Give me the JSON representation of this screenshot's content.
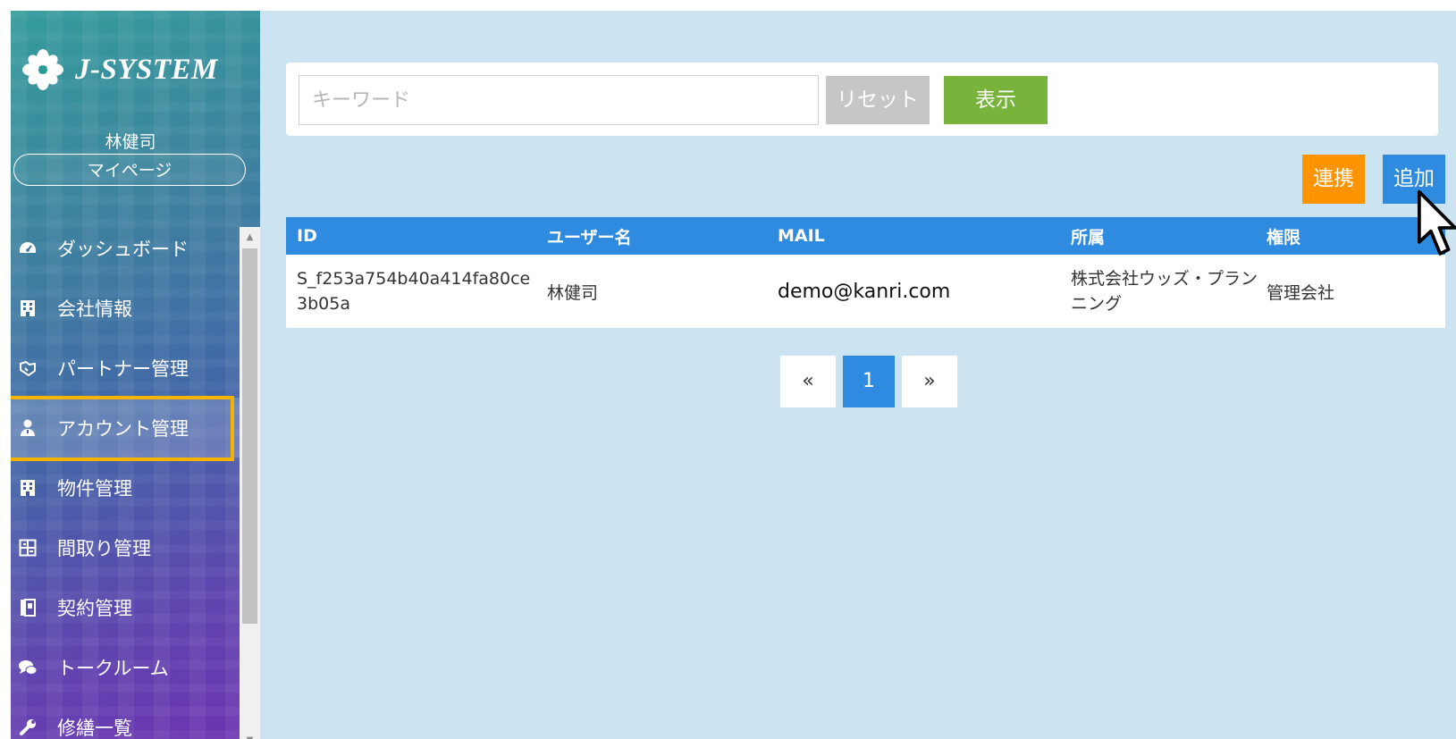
{
  "sidebar": {
    "brand": "J-SYSTEM",
    "user_name": "林健司",
    "mypage_label": "マイページ",
    "nav": [
      {
        "label": "ダッシュボード",
        "icon": "dashboard-icon"
      },
      {
        "label": "会社情報",
        "icon": "building-icon"
      },
      {
        "label": "パートナー管理",
        "icon": "handshake-icon"
      },
      {
        "label": "アカウント管理",
        "icon": "user-icon",
        "active": true
      },
      {
        "label": "物件管理",
        "icon": "building-icon"
      },
      {
        "label": "間取り管理",
        "icon": "floorplan-icon"
      },
      {
        "label": "契約管理",
        "icon": "book-icon"
      },
      {
        "label": "トークルーム",
        "icon": "chat-icon"
      },
      {
        "label": "修繕一覧",
        "icon": "wrench-icon"
      }
    ]
  },
  "search": {
    "placeholder": "キーワード",
    "value": "",
    "reset_label": "リセット",
    "show_label": "表示"
  },
  "actions": {
    "link_label": "連携",
    "add_label": "追加"
  },
  "table": {
    "headers": [
      "ID",
      "ユーザー名",
      "MAIL",
      "所属",
      "権限"
    ],
    "rows": [
      {
        "id": "S_f253a754b40a414fa80ce3b05a",
        "user": "林健司",
        "mail": "demo@kanri.com",
        "org": "株式会社ウッズ・プランニング",
        "role": "管理会社"
      }
    ]
  },
  "pagination": {
    "prev": "«",
    "current": "1",
    "next": "»"
  },
  "colors": {
    "primary": "#2f8be0",
    "show_button": "#78b33c",
    "link_button": "#ff9400",
    "reset_button": "#c6c6c6",
    "main_bg": "#cce3f2",
    "active_highlight": "#f6b400"
  }
}
